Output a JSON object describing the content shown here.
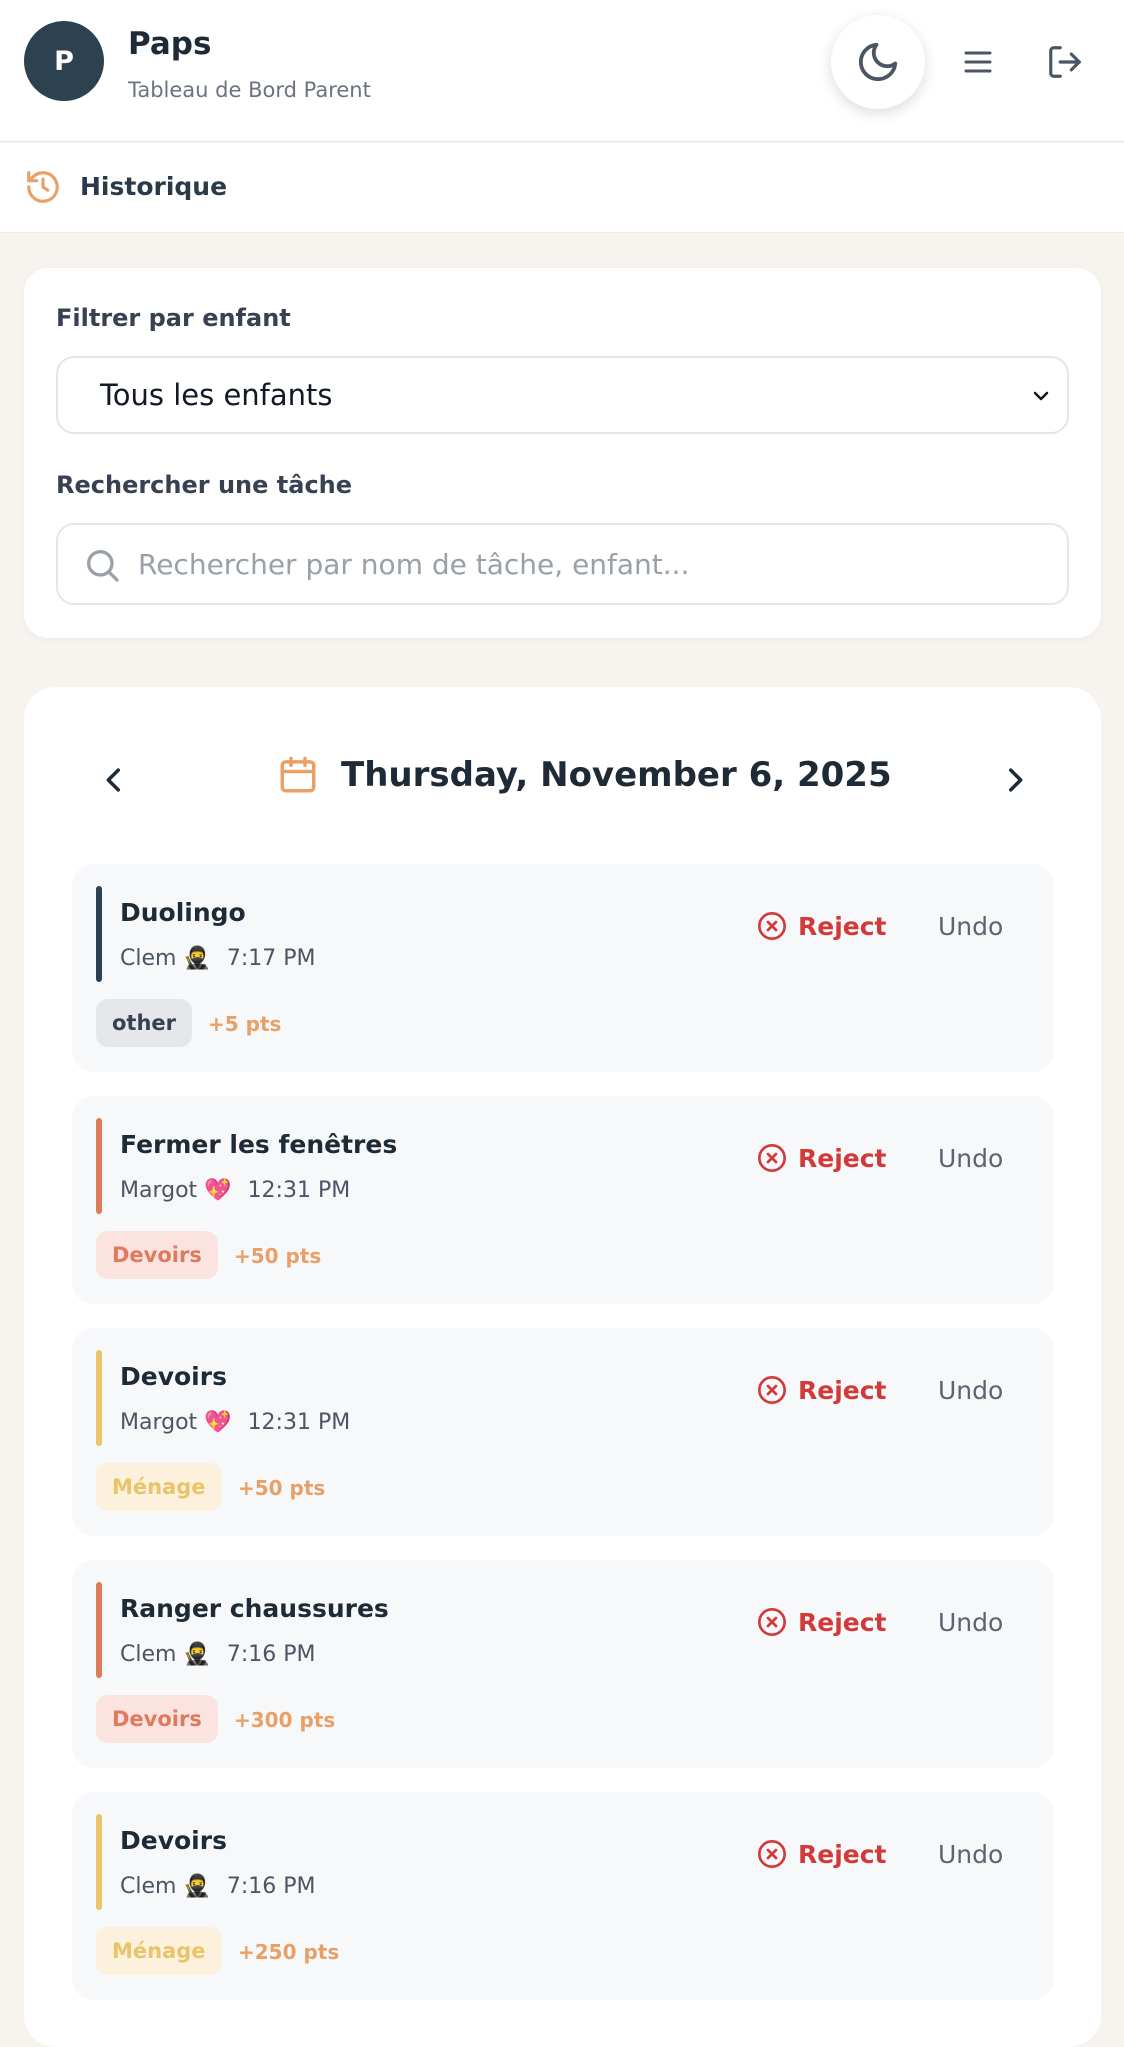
{
  "header": {
    "avatar_letter": "P",
    "user_name": "Paps",
    "subtitle": "Tableau de Bord Parent",
    "icons": [
      "moon-icon",
      "hamburger-menu-icon",
      "logout-icon"
    ]
  },
  "subnav": {
    "icon": "history-icon",
    "label": "Historique"
  },
  "filters": {
    "child_filter_label": "Filtrer par enfant",
    "child_filter_value": "Tous les enfants",
    "search_label": "Rechercher une tâche",
    "search_placeholder": "Rechercher par nom de tâche, enfant..."
  },
  "history": {
    "date_title": "Thursday, November 6, 2025",
    "reject_label": "Reject",
    "undo_label": "Undo",
    "tasks": [
      {
        "title": "Duolingo",
        "child": "Clem 🥷",
        "time": "7:17 PM",
        "category": "other",
        "points": "+5 pts",
        "accent": "#2c4250",
        "tag_bg": "#e5e7eb",
        "tag_color": "#374151"
      },
      {
        "title": "Fermer les fenêtres",
        "child": "Margot 💖",
        "time": "12:31 PM",
        "category": "Devoirs",
        "points": "+50 pts",
        "accent": "#e07a5f",
        "tag_bg": "#fbe4df",
        "tag_color": "#e07a5f"
      },
      {
        "title": "Devoirs",
        "child": "Margot 💖",
        "time": "12:31 PM",
        "category": "Ménage",
        "points": "+50 pts",
        "accent": "#e9c46a",
        "tag_bg": "#fbf1dc",
        "tag_color": "#e9c46a"
      },
      {
        "title": "Ranger chaussures",
        "child": "Clem 🥷",
        "time": "7:16 PM",
        "category": "Devoirs",
        "points": "+300 pts",
        "accent": "#e07a5f",
        "tag_bg": "#fbe4df",
        "tag_color": "#e07a5f"
      },
      {
        "title": "Devoirs",
        "child": "Clem 🥷",
        "time": "7:16 PM",
        "category": "Ménage",
        "points": "+250 pts",
        "accent": "#e9c46a",
        "tag_bg": "#fbf1dc",
        "tag_color": "#e9c46a"
      }
    ]
  },
  "colors": {
    "accent_orange": "#e8a067",
    "reject_red": "#d23a3a",
    "dark_navy": "#2c4250"
  }
}
